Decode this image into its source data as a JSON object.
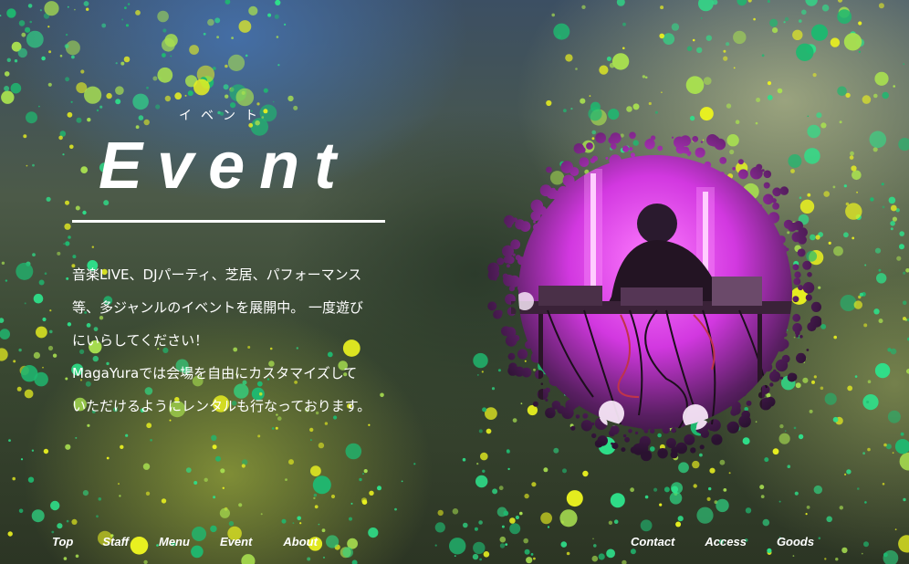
{
  "section": {
    "title_kana": "イベント",
    "title": "Event",
    "description": [
      "音楽LIVE、DJパーティ、芝居、パフォーマンス",
      "等、多ジャンルのイベントを展開中。 一度遊び",
      "にいらしてください！",
      "MagaYuraでは会場を自由にカスタマイズして",
      "いただけるようにレンタルも行なっております。"
    ]
  },
  "nav": {
    "left": [
      "Top",
      "Staff",
      "Menu",
      "Event",
      "About"
    ],
    "right": [
      "Contact",
      "Access",
      "Goods"
    ]
  },
  "colors": {
    "splatter_green": "#2ee08a",
    "splatter_yellow": "#e8f020",
    "splatter_lime": "#a8e050",
    "neon_pink": "#f060f0",
    "text": "#ffffff"
  },
  "images": {
    "photo": "dj-performance-photo"
  }
}
